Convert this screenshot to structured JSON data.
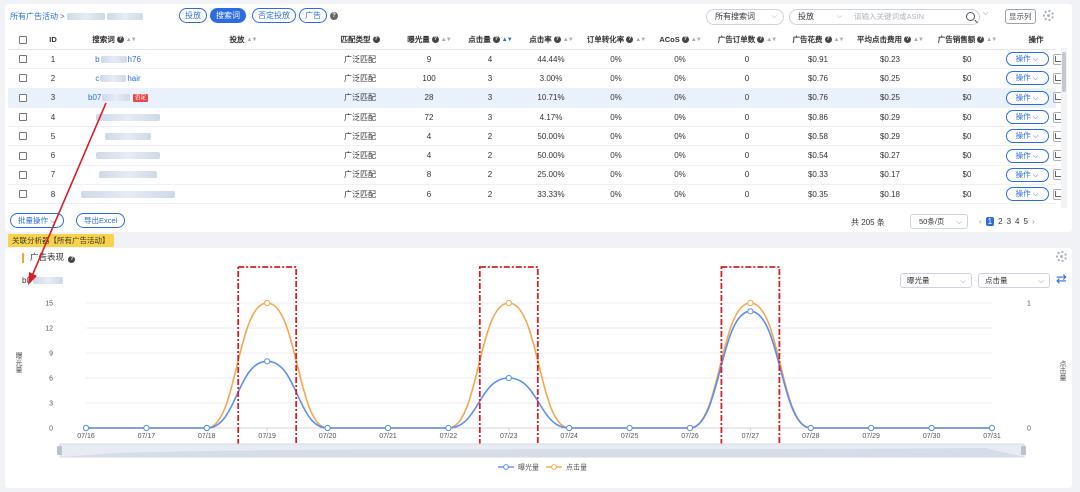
{
  "filterbar": {
    "crumb_label": "所有广告活动",
    "crumb_sep": ">",
    "pills": [
      {
        "label": "投放",
        "active": false
      },
      {
        "label": "搜索词",
        "active": true
      },
      {
        "label": "否定投放",
        "active": false
      },
      {
        "label": "广告",
        "active": false
      }
    ],
    "help": "?",
    "search_term_select": "所有搜索词",
    "target_select": "投放",
    "search_placeholder": "请输入关键词或ASIN",
    "column_button": "显示列"
  },
  "table": {
    "columns": [
      "ID",
      "搜索词",
      "投放",
      "匹配类型",
      "曝光量",
      "点击量",
      "点击率",
      "订单转化率",
      "ACoS",
      "广告订单数",
      "广告花费",
      "平均点击费用",
      "广告销售额",
      "操作"
    ],
    "rows": [
      {
        "id": "1",
        "term_start": "b",
        "term_end": "h76",
        "match": "广泛匹配",
        "impr": "9",
        "clicks": "4",
        "ctr": "44.44%",
        "cvr": "0%",
        "acos": "0%",
        "orders": "0",
        "spend": "$0.91",
        "cpc": "$0.23",
        "sales": "$0",
        "op": "操作"
      },
      {
        "id": "2",
        "term_start": "c",
        "term_end": "hair",
        "match": "广泛匹配",
        "impr": "100",
        "clicks": "3",
        "ctr": "3.00%",
        "cvr": "0%",
        "acos": "0%",
        "orders": "0",
        "spend": "$0.76",
        "cpc": "$0.25",
        "sales": "$0",
        "op": "操作"
      },
      {
        "id": "3",
        "term_start": "b07",
        "term_end": "",
        "tag": "否定",
        "match": "广泛匹配",
        "impr": "28",
        "clicks": "3",
        "ctr": "10.71%",
        "cvr": "0%",
        "acos": "0%",
        "orders": "0",
        "spend": "$0.76",
        "cpc": "$0.25",
        "sales": "$0",
        "op": "操作"
      },
      {
        "id": "4",
        "term_start": "",
        "term_end": "",
        "match": "广泛匹配",
        "impr": "72",
        "clicks": "3",
        "ctr": "4.17%",
        "cvr": "0%",
        "acos": "0%",
        "orders": "0",
        "spend": "$0.86",
        "cpc": "$0.29",
        "sales": "$0",
        "op": "操作"
      },
      {
        "id": "5",
        "term_start": "",
        "term_end": "",
        "match": "广泛匹配",
        "impr": "4",
        "clicks": "2",
        "ctr": "50.00%",
        "cvr": "0%",
        "acos": "0%",
        "orders": "0",
        "spend": "$0.58",
        "cpc": "$0.29",
        "sales": "$0",
        "op": "操作"
      },
      {
        "id": "6",
        "term_start": "",
        "term_end": "",
        "match": "广泛匹配",
        "impr": "4",
        "clicks": "2",
        "ctr": "50.00%",
        "cvr": "0%",
        "acos": "0%",
        "orders": "0",
        "spend": "$0.54",
        "cpc": "$0.27",
        "sales": "$0",
        "op": "操作"
      },
      {
        "id": "7",
        "term_start": "",
        "term_end": "",
        "match": "广泛匹配",
        "impr": "8",
        "clicks": "2",
        "ctr": "25.00%",
        "cvr": "0%",
        "acos": "0%",
        "orders": "0",
        "spend": "$0.33",
        "cpc": "$0.17",
        "sales": "$0",
        "op": "操作"
      },
      {
        "id": "8",
        "term_start": "",
        "term_end": "",
        "match": "广泛匹配",
        "impr": "6",
        "clicks": "2",
        "ctr": "33.33%",
        "cvr": "0%",
        "acos": "0%",
        "orders": "0",
        "spend": "$0.35",
        "cpc": "$0.18",
        "sales": "$0",
        "op": "操作"
      }
    ]
  },
  "footer": {
    "bulk_button": "批量操作",
    "export_button": "导出Excel",
    "total": "共 205 条",
    "page_size": "50条/页",
    "pages": [
      "1",
      "2",
      "3",
      "4",
      "5"
    ],
    "current_page": "1"
  },
  "section_tag": "关联分析器【所有广告活动】",
  "chart_panel": {
    "title": "广告表现",
    "asin_prefix": "b0",
    "metric_left": "曝光量",
    "metric_right": "点击量"
  },
  "colors": {
    "accent": "#2b6de0",
    "impressions": "#5b8ff0",
    "clicks": "#f3a84e",
    "annotation": "#d81f26"
  },
  "chart_data": {
    "type": "line",
    "x": [
      "07/16",
      "07/17",
      "07/18",
      "07/19",
      "07/20",
      "07/21",
      "07/22",
      "07/23",
      "07/24",
      "07/25",
      "07/26",
      "07/27",
      "07/28",
      "07/29",
      "07/30",
      "07/31"
    ],
    "series": [
      {
        "name": "曝光量",
        "axis": "left",
        "values": [
          0,
          0,
          0,
          8,
          0,
          0,
          0,
          6,
          0,
          0,
          0,
          14,
          0,
          0,
          0,
          0
        ]
      },
      {
        "name": "点击量",
        "axis": "right",
        "values": [
          0,
          0,
          0,
          1,
          0,
          0,
          0,
          1,
          0,
          0,
          0,
          1,
          0,
          0,
          0,
          0
        ]
      }
    ],
    "ylabel": "曝光量",
    "y2label": "点击量",
    "ylim": [
      0,
      15
    ],
    "yticks": [
      0,
      3,
      6,
      9,
      12,
      15
    ],
    "y2lim": [
      0,
      1
    ],
    "y2ticks": [
      0,
      1
    ],
    "highlight": [
      "07/19",
      "07/23",
      "07/27"
    ],
    "grid": true,
    "legend": "bottom-center"
  }
}
